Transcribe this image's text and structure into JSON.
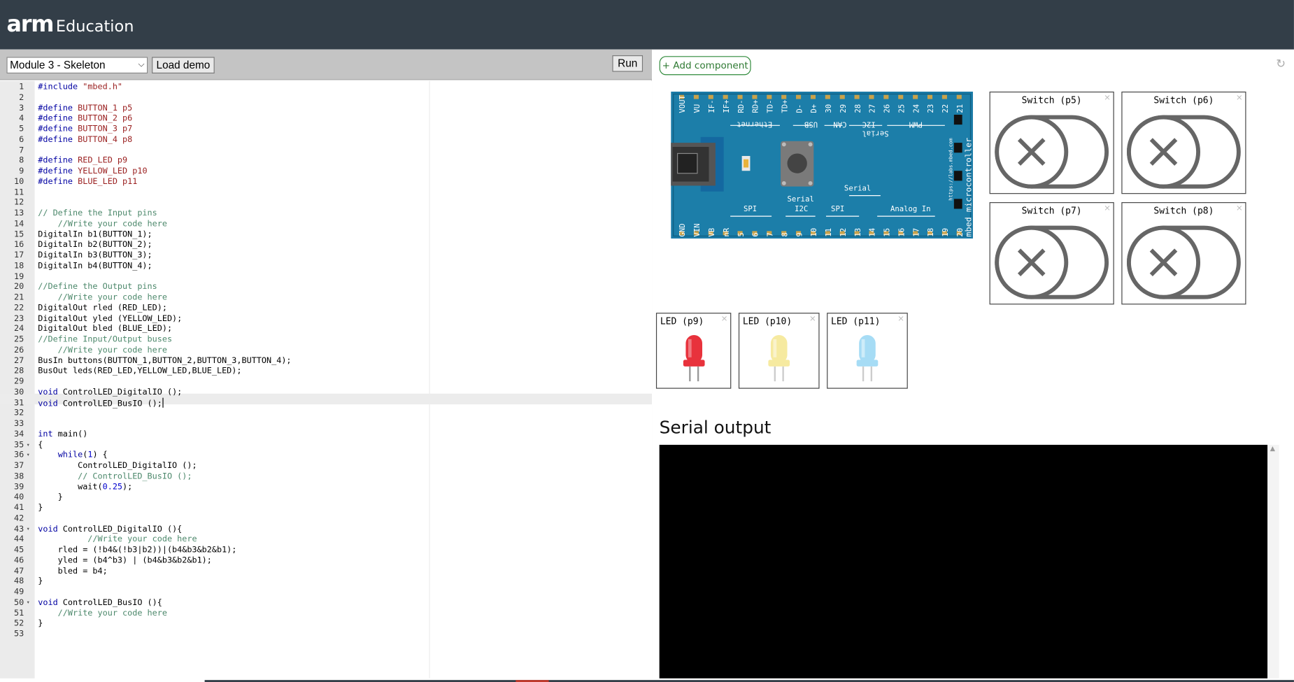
{
  "header": {
    "logo_arm": "arm",
    "logo_edu": "Education"
  },
  "toolbar": {
    "module_selected": "Module 3 - Skeleton",
    "load_demo": "Load demo",
    "run": "Run"
  },
  "editor": {
    "lines": [
      {
        "n": "1",
        "code": "#include \"mbed.h\""
      },
      {
        "n": "2",
        "code": ""
      },
      {
        "n": "3",
        "code": "#define BUTTON_1 p5"
      },
      {
        "n": "4",
        "code": "#define BUTTON_2 p6"
      },
      {
        "n": "5",
        "code": "#define BUTTON_3 p7"
      },
      {
        "n": "6",
        "code": "#define BUTTON_4 p8"
      },
      {
        "n": "7",
        "code": ""
      },
      {
        "n": "8",
        "code": "#define RED_LED p9"
      },
      {
        "n": "9",
        "code": "#define YELLOW_LED p10"
      },
      {
        "n": "10",
        "code": "#define BLUE_LED p11"
      },
      {
        "n": "11",
        "code": ""
      },
      {
        "n": "12",
        "code": ""
      },
      {
        "n": "13",
        "code": "// Define the Input pins"
      },
      {
        "n": "14",
        "code": "    //Write your code here"
      },
      {
        "n": "15",
        "code": "DigitalIn b1(BUTTON_1);"
      },
      {
        "n": "16",
        "code": "DigitalIn b2(BUTTON_2);"
      },
      {
        "n": "17",
        "code": "DigitalIn b3(BUTTON_3);"
      },
      {
        "n": "18",
        "code": "DigitalIn b4(BUTTON_4);"
      },
      {
        "n": "19",
        "code": ""
      },
      {
        "n": "20",
        "code": "//Define the Output pins"
      },
      {
        "n": "21",
        "code": "    //Write your code here"
      },
      {
        "n": "22",
        "code": "DigitalOut rled (RED_LED);"
      },
      {
        "n": "23",
        "code": "DigitalOut yled (YELLOW_LED);"
      },
      {
        "n": "24",
        "code": "DigitalOut bled (BLUE_LED);"
      },
      {
        "n": "25",
        "code": "//Define Input/Output buses"
      },
      {
        "n": "26",
        "code": "    //Write your code here"
      },
      {
        "n": "27",
        "code": "BusIn buttons(BUTTON_1,BUTTON_2,BUTTON_3,BUTTON_4);"
      },
      {
        "n": "28",
        "code": "BusOut leds(RED_LED,YELLOW_LED,BLUE_LED);"
      },
      {
        "n": "29",
        "code": ""
      },
      {
        "n": "30",
        "code": "void ControlLED_DigitalIO ();"
      },
      {
        "n": "31",
        "code": "void ControlLED_BusIO ();"
      },
      {
        "n": "32",
        "code": ""
      },
      {
        "n": "33",
        "code": ""
      },
      {
        "n": "34",
        "code": "int main()"
      },
      {
        "n": "35",
        "code": "{"
      },
      {
        "n": "36",
        "code": "    while(1) {"
      },
      {
        "n": "37",
        "code": "        ControlLED_DigitalIO ();"
      },
      {
        "n": "38",
        "code": "        // ControlLED_BusIO ();"
      },
      {
        "n": "39",
        "code": "        wait(0.25);"
      },
      {
        "n": "40",
        "code": "    }"
      },
      {
        "n": "41",
        "code": "}"
      },
      {
        "n": "42",
        "code": ""
      },
      {
        "n": "43",
        "code": "void ControlLED_DigitalIO (){"
      },
      {
        "n": "44",
        "code": "          //Write your code here"
      },
      {
        "n": "45",
        "code": "    rled = (!b4&(!b3|b2))|(b4&b3&b2&b1);"
      },
      {
        "n": "46",
        "code": "    yled = (b4^b3) | (b4&b3&b2&b1);"
      },
      {
        "n": "47",
        "code": "    bled = b4;"
      },
      {
        "n": "48",
        "code": "}"
      },
      {
        "n": "49",
        "code": ""
      },
      {
        "n": "50",
        "code": "void ControlLED_BusIO (){"
      },
      {
        "n": "51",
        "code": "    //Write your code here"
      },
      {
        "n": "52",
        "code": "}"
      },
      {
        "n": "53",
        "code": ""
      }
    ]
  },
  "simulator": {
    "add_component": "+ Add component",
    "board": {
      "top_pins": [
        "VOUT",
        "VU",
        "IF-",
        "IF+",
        "RD-",
        "RD+",
        "TD-",
        "TD+",
        "D-",
        "D+",
        "30",
        "29",
        "28",
        "27",
        "26",
        "25",
        "24",
        "23",
        "22",
        "21"
      ],
      "bottom_pins": [
        "GND",
        "VIN",
        "VB",
        "nR",
        "5",
        "6",
        "7",
        "8",
        "9",
        "10",
        "11",
        "12",
        "13",
        "14",
        "15",
        "16",
        "17",
        "18",
        "19",
        "20"
      ],
      "top_labels": [
        "Ethernet",
        "USB",
        "CAN",
        "I2C",
        "PWM"
      ],
      "serial_flipped": "Serial",
      "bottom_labels": [
        "SPI",
        "I2C",
        "SPI",
        "Analog In"
      ],
      "serial_labels": [
        "Serial",
        "Serial"
      ],
      "side_text": "mbed microcontroller",
      "url_text": "https://labs.mbed.com"
    },
    "switches": [
      {
        "label": "Switch (p5)"
      },
      {
        "label": "Switch (p6)"
      },
      {
        "label": "Switch (p7)"
      },
      {
        "label": "Switch (p8)"
      }
    ],
    "leds": [
      {
        "label": "LED (p9)",
        "color": "#e8323c"
      },
      {
        "label": "LED (p10)",
        "color": "#f6eaa0"
      },
      {
        "label": "LED (p11)",
        "color": "#a6dcf5"
      }
    ],
    "close_glyph": "×",
    "serial_title": "Serial output"
  }
}
